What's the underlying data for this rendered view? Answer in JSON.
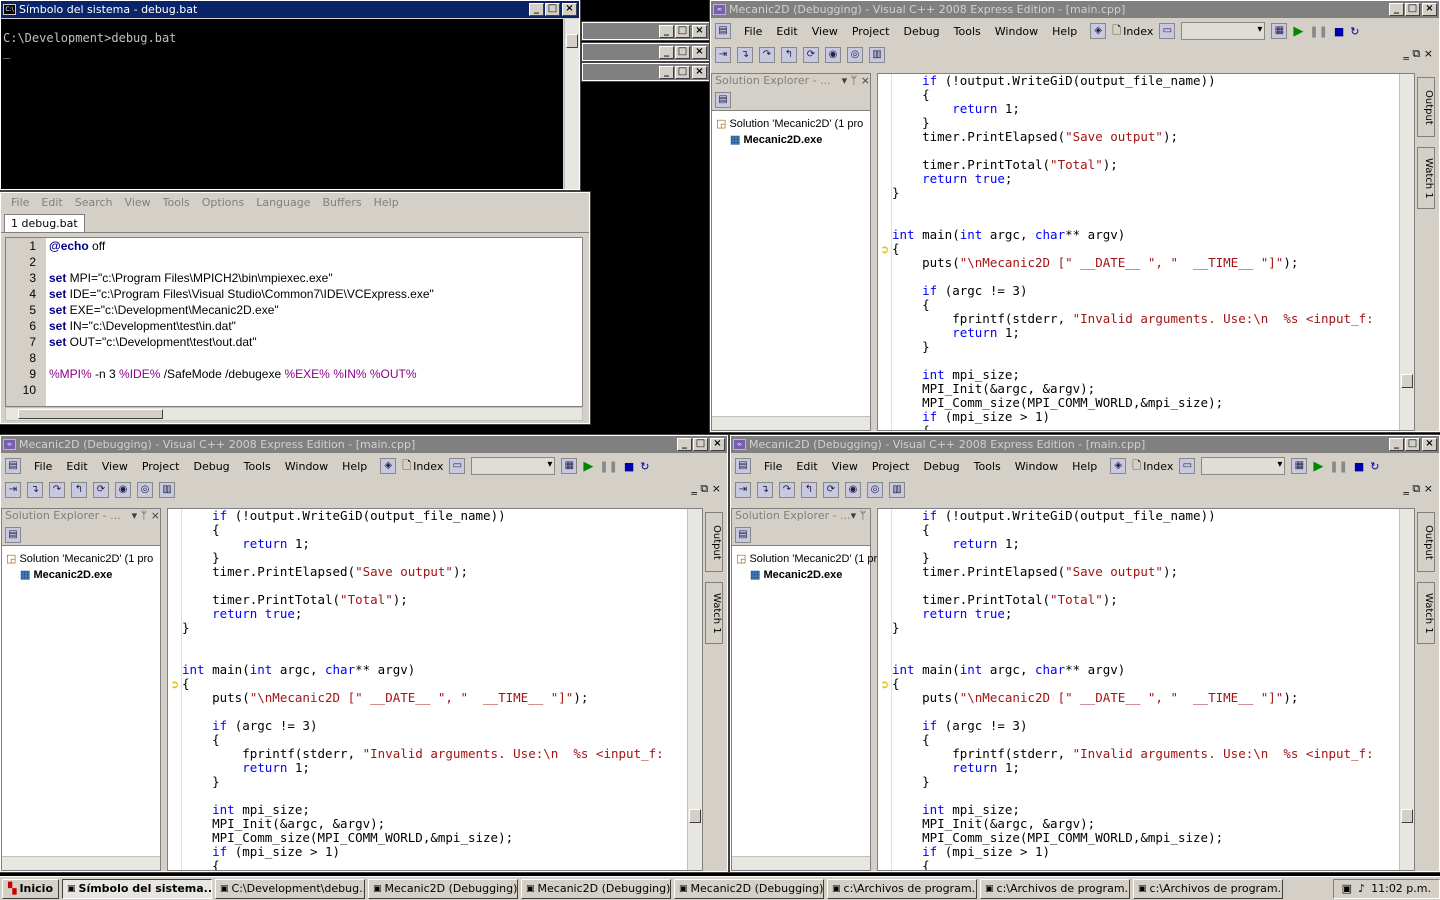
{
  "console": {
    "title": "Símbolo del sistema - debug.bat",
    "prompt": "C:\\Development>debug.bat",
    "cursor": "_"
  },
  "editor": {
    "menu": [
      "File",
      "Edit",
      "Search",
      "View",
      "Tools",
      "Options",
      "Language",
      "Buffers",
      "Help"
    ],
    "tab": "1 debug.bat",
    "lines": [
      {
        "n": "1",
        "segs": [
          {
            "t": "@",
            "c": "kw"
          },
          {
            "t": "echo",
            "c": "kw"
          },
          {
            "t": " off",
            "c": ""
          }
        ]
      },
      {
        "n": "2",
        "segs": []
      },
      {
        "n": "3",
        "segs": [
          {
            "t": "set",
            "c": "kw"
          },
          {
            "t": " MPI=\"c:\\Program Files\\MPICH2\\bin\\mpiexec.exe\"",
            "c": ""
          }
        ]
      },
      {
        "n": "4",
        "segs": [
          {
            "t": "set",
            "c": "kw"
          },
          {
            "t": " IDE=\"c:\\Program Files\\Visual Studio\\Common7\\IDE\\VCExpress.exe\"",
            "c": ""
          }
        ]
      },
      {
        "n": "5",
        "segs": [
          {
            "t": "set",
            "c": "kw"
          },
          {
            "t": " EXE=\"c:\\Development\\Mecanic2D.exe\"",
            "c": ""
          }
        ]
      },
      {
        "n": "6",
        "segs": [
          {
            "t": "set",
            "c": "kw"
          },
          {
            "t": " IN=\"c:\\Development\\test\\in.dat\"",
            "c": ""
          }
        ]
      },
      {
        "n": "7",
        "segs": [
          {
            "t": "set",
            "c": "kw"
          },
          {
            "t": " OUT=\"c:\\Development\\test\\out.dat\"",
            "c": ""
          }
        ]
      },
      {
        "n": "8",
        "segs": []
      },
      {
        "n": "9",
        "segs": [
          {
            "t": "%MPI%",
            "c": "var"
          },
          {
            "t": " -n 3 ",
            "c": ""
          },
          {
            "t": "%IDE%",
            "c": "var"
          },
          {
            "t": " /SafeMode /debugexe ",
            "c": ""
          },
          {
            "t": "%EXE%",
            "c": "var"
          },
          {
            "t": " ",
            "c": ""
          },
          {
            "t": "%IN%",
            "c": "var"
          },
          {
            "t": " ",
            "c": ""
          },
          {
            "t": "%OUT%",
            "c": "var"
          }
        ]
      },
      {
        "n": "10",
        "segs": []
      }
    ]
  },
  "vs": {
    "title": "Mecanic2D (Debugging) - Visual C++ 2008 Express Edition - [main.cpp]",
    "menu": [
      "File",
      "Edit",
      "View",
      "Project",
      "Debug",
      "Tools",
      "Window",
      "Help"
    ],
    "index_label": "Index",
    "solution_explorer": "Solution Explorer - ...",
    "solution": "Solution 'Mecanic2D' (1 pro",
    "project": "Mecanic2D.exe",
    "output_tab": "Output",
    "watch_tab": "Watch 1",
    "code": [
      [
        {
          "t": "    "
        },
        {
          "t": "if",
          "c": "kw"
        },
        {
          "t": " (!output.WriteGiD(output_file_name))"
        }
      ],
      [
        {
          "t": "    {"
        }
      ],
      [
        {
          "t": "        "
        },
        {
          "t": "return",
          "c": "kw"
        },
        {
          "t": " 1;"
        }
      ],
      [
        {
          "t": "    }"
        }
      ],
      [
        {
          "t": "    timer.PrintElapsed("
        },
        {
          "t": "\"Save output\"",
          "c": "str"
        },
        {
          "t": ");"
        }
      ],
      [
        {
          "t": ""
        }
      ],
      [
        {
          "t": "    timer.PrintTotal("
        },
        {
          "t": "\"Total\"",
          "c": "str"
        },
        {
          "t": ");"
        }
      ],
      [
        {
          "t": "    "
        },
        {
          "t": "return",
          "c": "kw"
        },
        {
          "t": " "
        },
        {
          "t": "true",
          "c": "kw"
        },
        {
          "t": ";"
        }
      ],
      [
        {
          "t": "}"
        }
      ],
      [
        {
          "t": ""
        }
      ],
      [
        {
          "t": ""
        }
      ],
      [
        {
          "t": "int",
          "c": "kw"
        },
        {
          "t": " main("
        },
        {
          "t": "int",
          "c": "kw"
        },
        {
          "t": " argc, "
        },
        {
          "t": "char",
          "c": "kw"
        },
        {
          "t": "** argv)"
        }
      ],
      [
        {
          "t": "{"
        }
      ],
      [
        {
          "t": "    puts("
        },
        {
          "t": "\"\\nMecanic2D [\" __DATE__ \", \"  __TIME__ \"]\"",
          "c": "str"
        },
        {
          "t": ");"
        }
      ],
      [
        {
          "t": ""
        }
      ],
      [
        {
          "t": "    "
        },
        {
          "t": "if",
          "c": "kw"
        },
        {
          "t": " (argc != 3)"
        }
      ],
      [
        {
          "t": "    {"
        }
      ],
      [
        {
          "t": "        fprintf(stderr, "
        },
        {
          "t": "\"Invalid arguments. Use:\\n  %s <input_f:",
          "c": "str"
        }
      ],
      [
        {
          "t": "        "
        },
        {
          "t": "return",
          "c": "kw"
        },
        {
          "t": " 1;"
        }
      ],
      [
        {
          "t": "    }"
        }
      ],
      [
        {
          "t": ""
        }
      ],
      [
        {
          "t": "    "
        },
        {
          "t": "int",
          "c": "kw"
        },
        {
          "t": " mpi_size;"
        }
      ],
      [
        {
          "t": "    MPI_Init(&argc, &argv);"
        }
      ],
      [
        {
          "t": "    MPI_Comm_size(MPI_COMM_WORLD,&mpi_size);"
        }
      ],
      [
        {
          "t": "    "
        },
        {
          "t": "if",
          "c": "kw"
        },
        {
          "t": " (mpi_size > 1)"
        }
      ],
      [
        {
          "t": "    {"
        }
      ]
    ]
  },
  "taskbar": {
    "start": "Inicio",
    "tasks": [
      "Símbolo del sistema...",
      "C:\\Development\\debug...",
      "Mecanic2D (Debugging)...",
      "Mecanic2D (Debugging)...",
      "Mecanic2D (Debugging)...",
      "c:\\Archivos de program...",
      "c:\\Archivos de program...",
      "c:\\Archivos de program..."
    ],
    "clock": "11:02 p.m."
  }
}
